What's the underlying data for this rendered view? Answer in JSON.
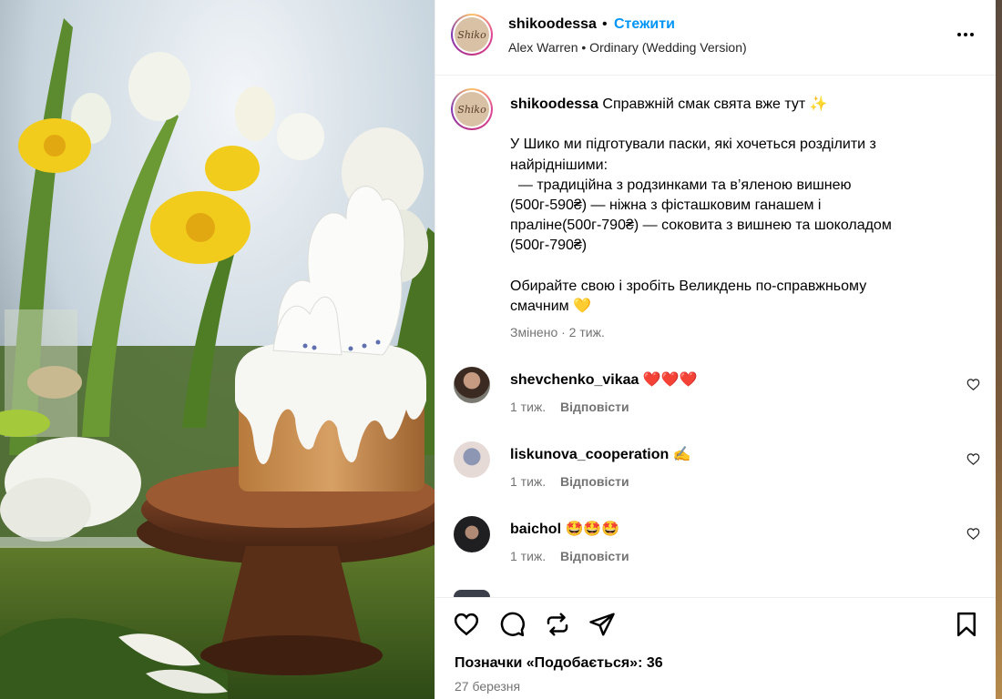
{
  "post": {
    "username": "shikoodessa",
    "follow_label": "Стежити",
    "separator": "•",
    "music": "Alex Warren • Ordinary (Wedding Version)",
    "avatar_text": "Shiko",
    "caption_headline": " Справжній смак свята вже тут ✨",
    "caption_body": "У Шико ми підготували паски, які хочеться розділити з найріднішими:\n  — традиційна з родзинками та в’яленою вишнею (500г-590₴) — ніжна з фісташковим ганашем і праліне(500г-790₴) — соковита з вишнею та шоколадом (500г-790₴)\n\nОбирайте свою і зробіть Великдень по-справжньому смачним 💛",
    "edited": "Змінено · 2 тиж."
  },
  "comments": [
    {
      "username": "shevchenko_vikaa",
      "text": "❤️❤️❤️",
      "time": "1 тиж.",
      "reply_label": "Відповісти"
    },
    {
      "username": "liskunova_cooperation",
      "text": "✍️",
      "time": "1 тиж.",
      "reply_label": "Відповісти"
    },
    {
      "username": "baichol",
      "text": "🤩🤩🤩",
      "time": "1 тиж.",
      "reply_label": "Відповісти"
    }
  ],
  "footer": {
    "likes": "Позначки «Подобається»: 36",
    "date": "27 березня"
  },
  "icons": {
    "more": "more-horizontal-icon",
    "like": "heart-icon",
    "comment": "comment-icon",
    "repost": "repost-icon",
    "share": "share-icon",
    "save": "bookmark-icon"
  },
  "colors": {
    "follow": "#0095f6",
    "muted": "#737373",
    "border": "#efefef"
  }
}
